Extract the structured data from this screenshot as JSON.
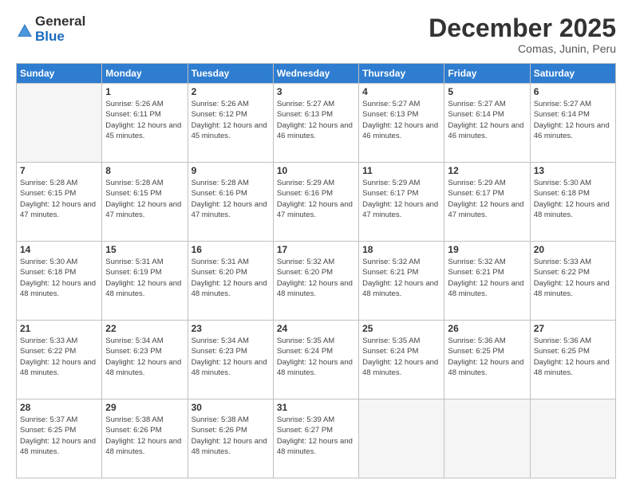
{
  "logo": {
    "general": "General",
    "blue": "Blue"
  },
  "header": {
    "title": "December 2025",
    "subtitle": "Comas, Junin, Peru"
  },
  "weekdays": [
    "Sunday",
    "Monday",
    "Tuesday",
    "Wednesday",
    "Thursday",
    "Friday",
    "Saturday"
  ],
  "weeks": [
    [
      {
        "day": "",
        "empty": true
      },
      {
        "day": "1",
        "sunrise": "Sunrise: 5:26 AM",
        "sunset": "Sunset: 6:11 PM",
        "daylight": "Daylight: 12 hours and 45 minutes."
      },
      {
        "day": "2",
        "sunrise": "Sunrise: 5:26 AM",
        "sunset": "Sunset: 6:12 PM",
        "daylight": "Daylight: 12 hours and 45 minutes."
      },
      {
        "day": "3",
        "sunrise": "Sunrise: 5:27 AM",
        "sunset": "Sunset: 6:13 PM",
        "daylight": "Daylight: 12 hours and 46 minutes."
      },
      {
        "day": "4",
        "sunrise": "Sunrise: 5:27 AM",
        "sunset": "Sunset: 6:13 PM",
        "daylight": "Daylight: 12 hours and 46 minutes."
      },
      {
        "day": "5",
        "sunrise": "Sunrise: 5:27 AM",
        "sunset": "Sunset: 6:14 PM",
        "daylight": "Daylight: 12 hours and 46 minutes."
      },
      {
        "day": "6",
        "sunrise": "Sunrise: 5:27 AM",
        "sunset": "Sunset: 6:14 PM",
        "daylight": "Daylight: 12 hours and 46 minutes."
      }
    ],
    [
      {
        "day": "7",
        "sunrise": "Sunrise: 5:28 AM",
        "sunset": "Sunset: 6:15 PM",
        "daylight": "Daylight: 12 hours and 47 minutes."
      },
      {
        "day": "8",
        "sunrise": "Sunrise: 5:28 AM",
        "sunset": "Sunset: 6:15 PM",
        "daylight": "Daylight: 12 hours and 47 minutes."
      },
      {
        "day": "9",
        "sunrise": "Sunrise: 5:28 AM",
        "sunset": "Sunset: 6:16 PM",
        "daylight": "Daylight: 12 hours and 47 minutes."
      },
      {
        "day": "10",
        "sunrise": "Sunrise: 5:29 AM",
        "sunset": "Sunset: 6:16 PM",
        "daylight": "Daylight: 12 hours and 47 minutes."
      },
      {
        "day": "11",
        "sunrise": "Sunrise: 5:29 AM",
        "sunset": "Sunset: 6:17 PM",
        "daylight": "Daylight: 12 hours and 47 minutes."
      },
      {
        "day": "12",
        "sunrise": "Sunrise: 5:29 AM",
        "sunset": "Sunset: 6:17 PM",
        "daylight": "Daylight: 12 hours and 47 minutes."
      },
      {
        "day": "13",
        "sunrise": "Sunrise: 5:30 AM",
        "sunset": "Sunset: 6:18 PM",
        "daylight": "Daylight: 12 hours and 48 minutes."
      }
    ],
    [
      {
        "day": "14",
        "sunrise": "Sunrise: 5:30 AM",
        "sunset": "Sunset: 6:18 PM",
        "daylight": "Daylight: 12 hours and 48 minutes."
      },
      {
        "day": "15",
        "sunrise": "Sunrise: 5:31 AM",
        "sunset": "Sunset: 6:19 PM",
        "daylight": "Daylight: 12 hours and 48 minutes."
      },
      {
        "day": "16",
        "sunrise": "Sunrise: 5:31 AM",
        "sunset": "Sunset: 6:20 PM",
        "daylight": "Daylight: 12 hours and 48 minutes."
      },
      {
        "day": "17",
        "sunrise": "Sunrise: 5:32 AM",
        "sunset": "Sunset: 6:20 PM",
        "daylight": "Daylight: 12 hours and 48 minutes."
      },
      {
        "day": "18",
        "sunrise": "Sunrise: 5:32 AM",
        "sunset": "Sunset: 6:21 PM",
        "daylight": "Daylight: 12 hours and 48 minutes."
      },
      {
        "day": "19",
        "sunrise": "Sunrise: 5:32 AM",
        "sunset": "Sunset: 6:21 PM",
        "daylight": "Daylight: 12 hours and 48 minutes."
      },
      {
        "day": "20",
        "sunrise": "Sunrise: 5:33 AM",
        "sunset": "Sunset: 6:22 PM",
        "daylight": "Daylight: 12 hours and 48 minutes."
      }
    ],
    [
      {
        "day": "21",
        "sunrise": "Sunrise: 5:33 AM",
        "sunset": "Sunset: 6:22 PM",
        "daylight": "Daylight: 12 hours and 48 minutes."
      },
      {
        "day": "22",
        "sunrise": "Sunrise: 5:34 AM",
        "sunset": "Sunset: 6:23 PM",
        "daylight": "Daylight: 12 hours and 48 minutes."
      },
      {
        "day": "23",
        "sunrise": "Sunrise: 5:34 AM",
        "sunset": "Sunset: 6:23 PM",
        "daylight": "Daylight: 12 hours and 48 minutes."
      },
      {
        "day": "24",
        "sunrise": "Sunrise: 5:35 AM",
        "sunset": "Sunset: 6:24 PM",
        "daylight": "Daylight: 12 hours and 48 minutes."
      },
      {
        "day": "25",
        "sunrise": "Sunrise: 5:35 AM",
        "sunset": "Sunset: 6:24 PM",
        "daylight": "Daylight: 12 hours and 48 minutes."
      },
      {
        "day": "26",
        "sunrise": "Sunrise: 5:36 AM",
        "sunset": "Sunset: 6:25 PM",
        "daylight": "Daylight: 12 hours and 48 minutes."
      },
      {
        "day": "27",
        "sunrise": "Sunrise: 5:36 AM",
        "sunset": "Sunset: 6:25 PM",
        "daylight": "Daylight: 12 hours and 48 minutes."
      }
    ],
    [
      {
        "day": "28",
        "sunrise": "Sunrise: 5:37 AM",
        "sunset": "Sunset: 6:25 PM",
        "daylight": "Daylight: 12 hours and 48 minutes."
      },
      {
        "day": "29",
        "sunrise": "Sunrise: 5:38 AM",
        "sunset": "Sunset: 6:26 PM",
        "daylight": "Daylight: 12 hours and 48 minutes."
      },
      {
        "day": "30",
        "sunrise": "Sunrise: 5:38 AM",
        "sunset": "Sunset: 6:26 PM",
        "daylight": "Daylight: 12 hours and 48 minutes."
      },
      {
        "day": "31",
        "sunrise": "Sunrise: 5:39 AM",
        "sunset": "Sunset: 6:27 PM",
        "daylight": "Daylight: 12 hours and 48 minutes."
      },
      {
        "day": "",
        "empty": true
      },
      {
        "day": "",
        "empty": true
      },
      {
        "day": "",
        "empty": true
      }
    ]
  ]
}
